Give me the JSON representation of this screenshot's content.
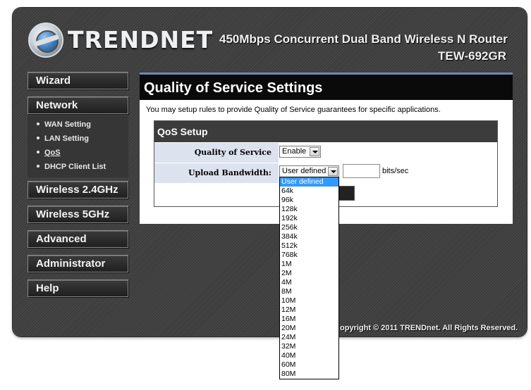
{
  "header": {
    "brand": "TRENDNET",
    "model_description": "450Mbps Concurrent Dual Band Wireless N Router",
    "model_number": "TEW-692GR"
  },
  "sidebar": {
    "wizard": "Wizard",
    "network": "Network",
    "network_items": [
      "WAN Setting",
      "LAN Setting",
      "QoS",
      "DHCP Client List"
    ],
    "wireless_24": "Wireless 2.4GHz",
    "wireless_5": "Wireless 5GHz",
    "advanced": "Advanced",
    "administrator": "Administrator",
    "help": "Help"
  },
  "content": {
    "title": "Quality of Service Settings",
    "description": "You may setup rules to provide Quality of Service guarantees for specific applications.",
    "qos_setup": {
      "title": "QoS Setup",
      "qos_label": "Quality of Service",
      "qos_value": "Enable",
      "upload_label": "Upload Bandwidth:",
      "upload_value": "User defined",
      "upload_unit": "bits/sec"
    }
  },
  "dropdown": {
    "options": [
      "User defined",
      "64k",
      "96k",
      "128k",
      "192k",
      "256k",
      "384k",
      "512k",
      "768k",
      "1M",
      "2M",
      "4M",
      "8M",
      "10M",
      "12M",
      "16M",
      "20M",
      "24M",
      "32M",
      "40M",
      "60M",
      "80M"
    ],
    "selected": "User defined"
  },
  "footer": {
    "copyright": "opyright © 2011 TRENDnet. All Rights Reserved."
  },
  "colors": {
    "accent_blue": "#6f89b3",
    "label_bg": "#dde3ee",
    "selected_option": "#3399ff"
  }
}
